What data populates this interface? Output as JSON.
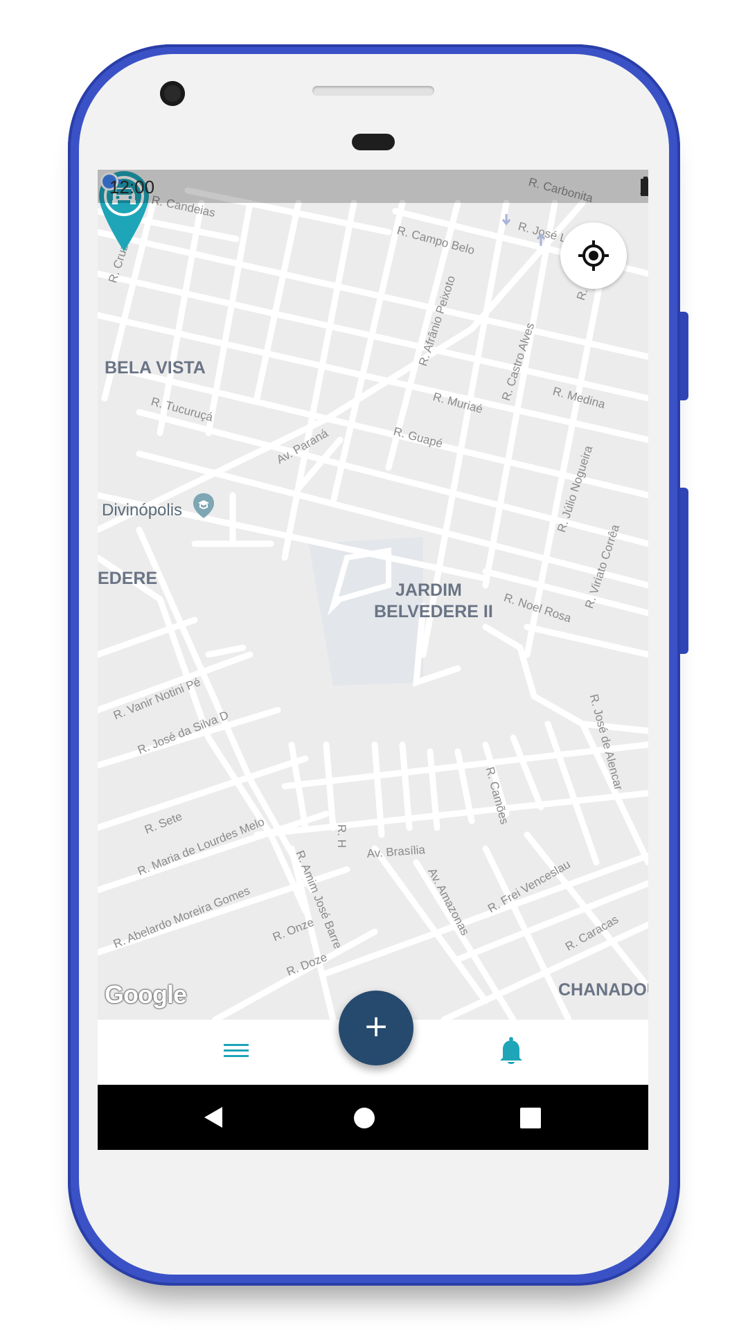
{
  "status_bar": {
    "time": "12:00"
  },
  "map": {
    "area_labels": [
      "BELA VISTA",
      "EDERE",
      "JARDIM",
      "BELVEDERE II",
      "CHANADOU"
    ],
    "poi": {
      "name": "Divinópolis",
      "icon": "school-pin-icon"
    },
    "street_labels": [
      "R. Candeias",
      "R. Cruz e Souza",
      "R. Campo Belo",
      "R. José L",
      "R. Carbonita",
      "R. Afrânio Peixoto",
      "R. Castro Alves",
      "R. Ama",
      "R. Tucuruçá",
      "R. Muriaé",
      "R. Medina",
      "Av. Paraná",
      "R. Guapé",
      "R. Júlio Nogueira",
      "R. Viriato Corrêa",
      "R. Noel Rosa",
      "R. Vanir Notini Pé",
      "R. José da Silva D",
      "R. José de Alencar",
      "R. Camões",
      "R. Sete",
      "R. Maria de Lourdes Melo",
      "R. H",
      "Av. Brasília",
      "R. Abelardo Moreira Gomes",
      "R. Amim José Barre",
      "Av. Amazonas",
      "R. Frei Venceslau",
      "R. Onze",
      "R. Doze",
      "R. Caracas"
    ],
    "attribution": "Google"
  },
  "buttons": {
    "locate_icon": "my-location-icon",
    "fab_label": "+",
    "menu_icon": "menu-icon",
    "notifications_icon": "bell-icon"
  },
  "colors": {
    "accent": "#1ea5b8",
    "fab": "#26496e",
    "phone_frame": "#3a52c6",
    "location_dot": "#4285f4"
  }
}
